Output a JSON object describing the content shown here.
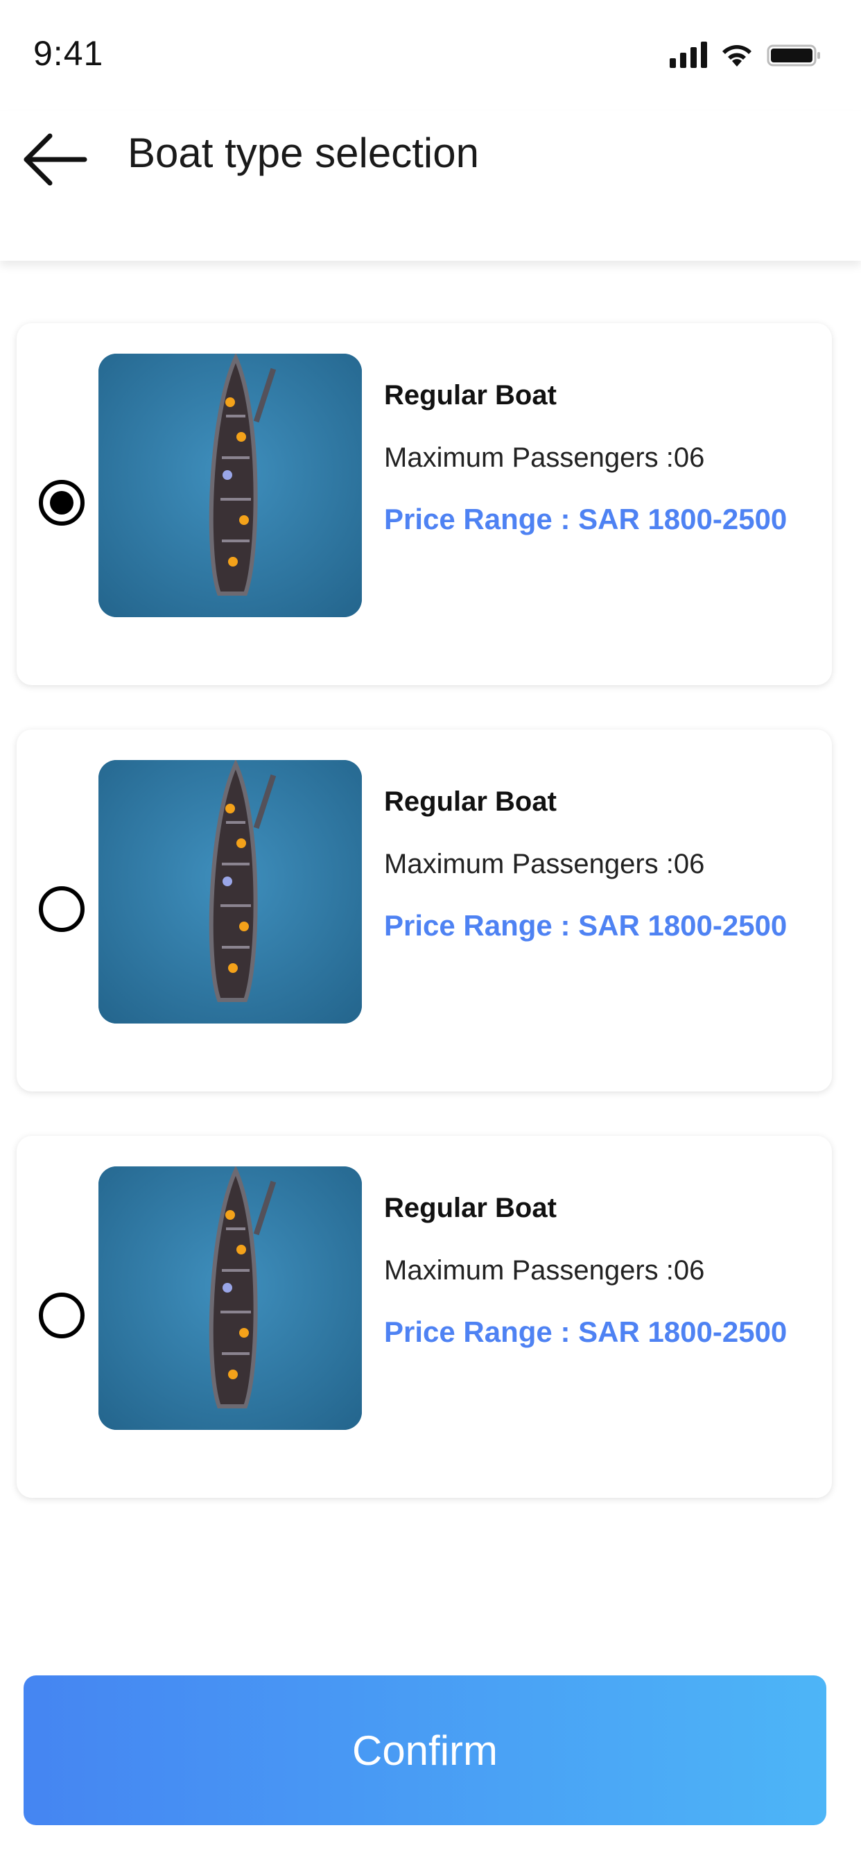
{
  "status_bar": {
    "time": "9:41"
  },
  "header": {
    "title": "Boat type selection",
    "back_icon": "arrow-left-icon"
  },
  "boats": [
    {
      "selected": true,
      "name": "Regular Boat",
      "passengers": "Maximum Passengers :06",
      "price": "Price Range : SAR 1800-2500"
    },
    {
      "selected": false,
      "name": "Regular Boat",
      "passengers": "Maximum Passengers :06",
      "price": "Price Range : SAR 1800-2500"
    },
    {
      "selected": false,
      "name": "Regular Boat",
      "passengers": "Maximum Passengers :06",
      "price": "Price Range : SAR 1800-2500"
    }
  ],
  "confirm_label": "Confirm",
  "colors": {
    "accent": "#4e82f3",
    "button_gradient_start": "#4585f2",
    "button_gradient_end": "#4db5f7"
  }
}
